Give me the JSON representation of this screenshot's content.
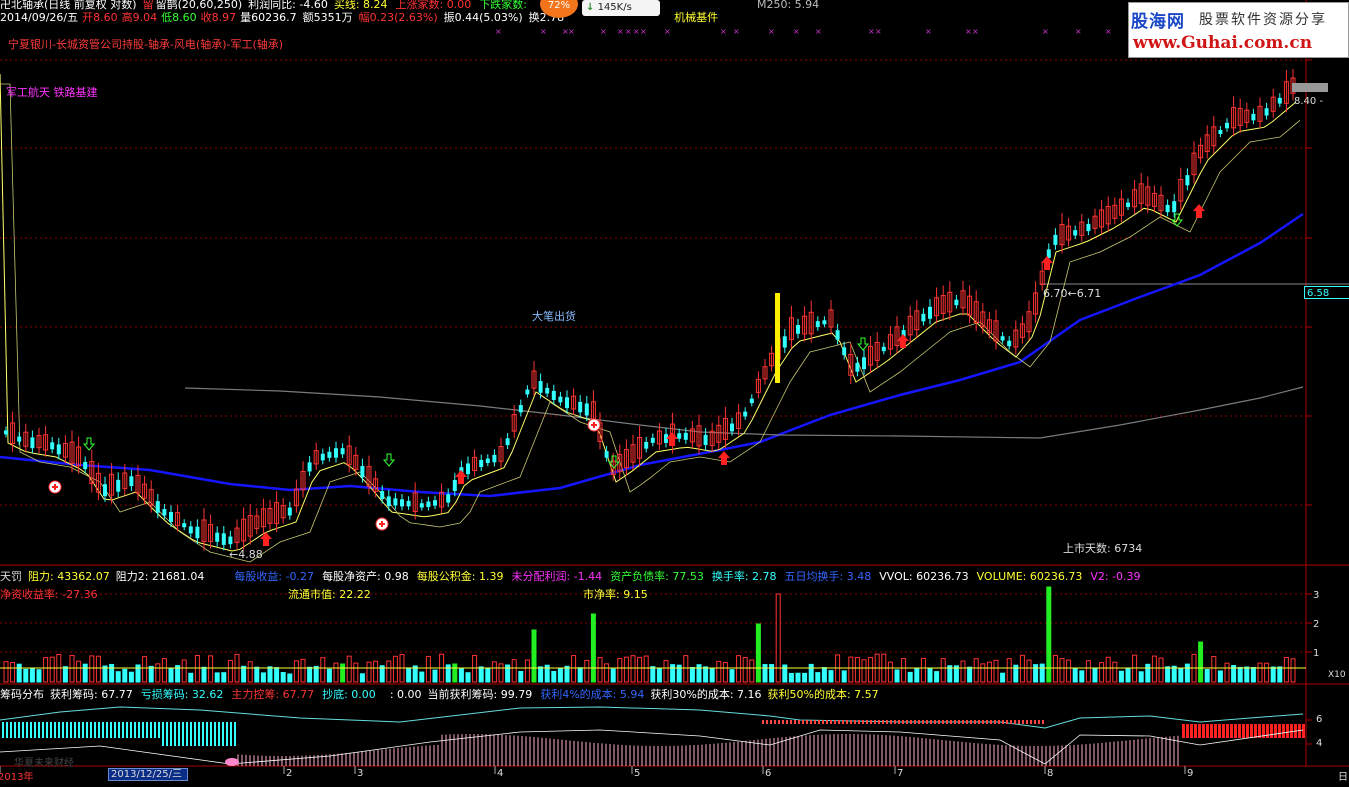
{
  "header": {
    "line1": [
      {
        "text": "卍北轴承(日线 前复权 对数)",
        "color": "#ffffff"
      },
      {
        "text": "留",
        "color": "#ff3333",
        "icon": "arrow-up-icon"
      },
      {
        "text": "留鹊(20,60,250)",
        "color": "#ffffff"
      },
      {
        "text": "利润同比: -4.60",
        "color": "#ffffff"
      },
      {
        "text": "买线: 8.24",
        "color": "#ffff33"
      },
      {
        "text": "上涨家数: 0.00",
        "color": "#ff3333"
      },
      {
        "text": "下跌家数:",
        "color": "#33ff33"
      },
      {
        "text": "M250: 5.94",
        "color": "#bbbbbb"
      }
    ],
    "line2": [
      {
        "text": "2014/09/26/五",
        "color": "#ffffff"
      },
      {
        "text": "开8.60",
        "color": "#ff3333"
      },
      {
        "text": "高9.04",
        "color": "#ff3333"
      },
      {
        "text": "低8.60",
        "color": "#33ff33"
      },
      {
        "text": "收8.97",
        "color": "#ff3333"
      },
      {
        "text": "量60236.7",
        "color": "#ffffff"
      },
      {
        "text": "额5351万",
        "color": "#ffffff"
      },
      {
        "text": "幅0.23(2.63%)",
        "color": "#ff3333"
      },
      {
        "text": "振0.44(5.03%)",
        "color": "#ffffff"
      },
      {
        "text": "换2.78",
        "color": "#ffffff"
      },
      {
        "text": "机械基件",
        "color": "#ffff33"
      }
    ],
    "subtitle": "宁夏银川-长城资管公司持股-轴承-风电(轴承)-军工(轴承)",
    "sector_tags": "军工航天 铁路基建",
    "badge": "72%",
    "net_speed": "145K/s"
  },
  "logo": {
    "name": "股海网",
    "slogan": "股票软件资源分享",
    "url": "www.Guhai.com.cn"
  },
  "chart_annotations": {
    "big_order": "大笔出货",
    "low_label": "←4.88",
    "level_label": "6.70←6.71",
    "top_label": "8.40 -",
    "listing_days": "上市天数: 6734"
  },
  "price_axis": {
    "current": "6.58"
  },
  "indicator_row1": [
    {
      "text": "天罚",
      "color": "#dddddd"
    },
    {
      "text": "阻力: 43362.07",
      "color": "#ffff33"
    },
    {
      "text": "阻力2: 21681.04",
      "color": "#ffffff"
    },
    {
      "text": "每股收益: -0.27",
      "color": "#3366ff"
    },
    {
      "text": "每股净资产: 0.98",
      "color": "#ffffff"
    },
    {
      "text": "每股公积金: 1.39",
      "color": "#ffff33"
    },
    {
      "text": "未分配利润: -1.44",
      "color": "#ff33ff"
    },
    {
      "text": "资产负债率: 77.53",
      "color": "#33ff33"
    },
    {
      "text": "换手率: 2.78",
      "color": "#33ffff"
    },
    {
      "text": "五日均换手: 3.48",
      "color": "#3366ff"
    },
    {
      "text": "VVOL: 60236.73",
      "color": "#ffffff"
    },
    {
      "text": "VOLUME: 60236.73",
      "color": "#ffff33"
    },
    {
      "text": "V2: -0.39",
      "color": "#ff33ff"
    }
  ],
  "indicator_row2": [
    {
      "text": "净资收益率: -27.36",
      "color": "#ff3333"
    },
    {
      "text": "流通市值: 22.22",
      "color": "#ffff33"
    },
    {
      "text": "市净率: 9.15",
      "color": "#ffff33"
    }
  ],
  "volume_axis": [
    "3",
    "2",
    "1",
    "X10"
  ],
  "chip_row": [
    {
      "text": "筹码分布",
      "color": "#ffffff"
    },
    {
      "text": "获利筹码: 67.77",
      "color": "#ffffff"
    },
    {
      "text": "亏损筹码: 32.62",
      "color": "#33ffff"
    },
    {
      "text": "主力控筹: 67.77",
      "color": "#ff3333"
    },
    {
      "text": "抄底: 0.00",
      "color": "#33ffff"
    },
    {
      "text": ": 0.00",
      "color": "#ffffff"
    },
    {
      "text": "当前获利筹码: 99.79",
      "color": "#ffffff"
    },
    {
      "text": "获利4%的成本: 5.94",
      "color": "#3366ff"
    },
    {
      "text": "获利30%的成本: 7.16",
      "color": "#ffffff"
    },
    {
      "text": "获利50%的成本: 7.57",
      "color": "#ffff33"
    }
  ],
  "chip_axis": [
    "6",
    "4"
  ],
  "time_axis": {
    "labels": [
      "2013年",
      "2",
      "3",
      "4",
      "5",
      "6",
      "7",
      "8",
      "9"
    ],
    "cursor_date": "2013/12/25/三",
    "watermark": "华夏未来财经",
    "right": "日"
  },
  "colors": {
    "up": "#ff3333",
    "down": "#33ffff",
    "grid": "#8b0000",
    "ma60": "#1515ff",
    "ma_fast": "#ffff66",
    "ma_mid": "#c8c870",
    "ma250": "#7a7a7a",
    "vol_spike": "#22ee22",
    "panel_border": "#b00000"
  }
}
